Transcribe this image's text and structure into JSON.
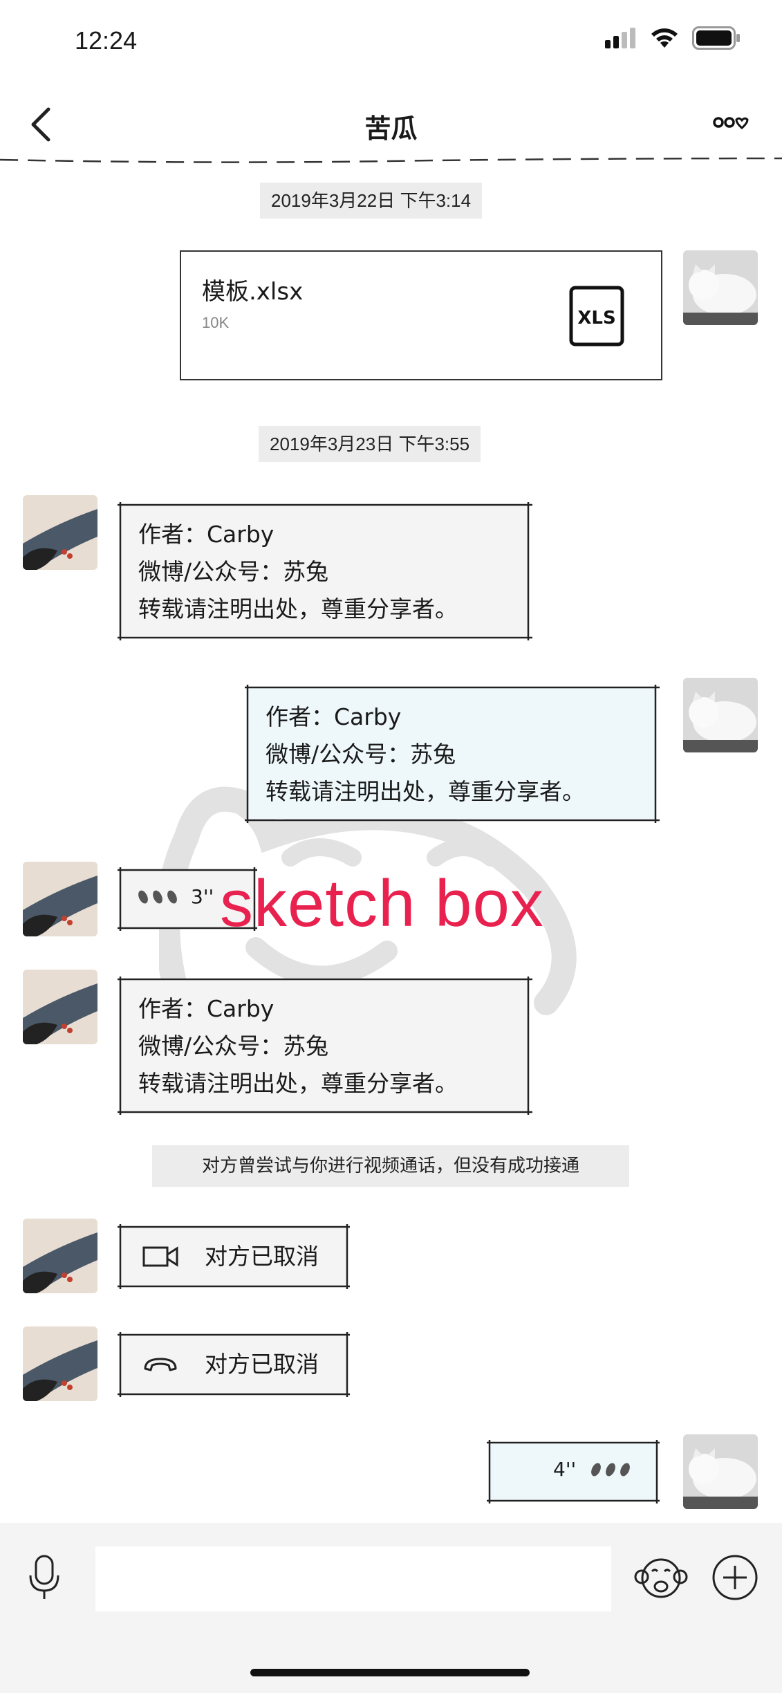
{
  "status_bar": {
    "time": "12:24"
  },
  "nav": {
    "title": "苦瓜"
  },
  "messages": {
    "time1": "2019年3月22日 下午3:14",
    "file": {
      "name": "模板.xlsx",
      "size": "10K",
      "type_label": "XLS"
    },
    "time2": "2019年3月23日 下午3:55",
    "text1": {
      "line1": "作者：Carby",
      "line2": "微博/公众号：苏兔",
      "line3": "转载请注明出处，尊重分享者。"
    },
    "text2": {
      "line1": "作者：Carby",
      "line2": "微博/公众号：苏兔",
      "line3": "转载请注明出处，尊重分享者。"
    },
    "voice1": {
      "duration": "3''"
    },
    "text3": {
      "line1": "作者：Carby",
      "line2": "微博/公众号：苏兔",
      "line3": "转载请注明出处，尊重分享者。"
    },
    "system_notice": "对方曾尝试与你进行视频通话，但没有成功接通",
    "video_call": {
      "label": "对方已取消"
    },
    "voice_call": {
      "label": "对方已取消"
    },
    "voice2": {
      "duration": "4''"
    }
  },
  "watermark": {
    "text": "sketch box"
  },
  "colors": {
    "sent_bubble": "#eef8fb",
    "received_bubble": "#f4f4f4",
    "watermark_text": "#e8214f"
  }
}
